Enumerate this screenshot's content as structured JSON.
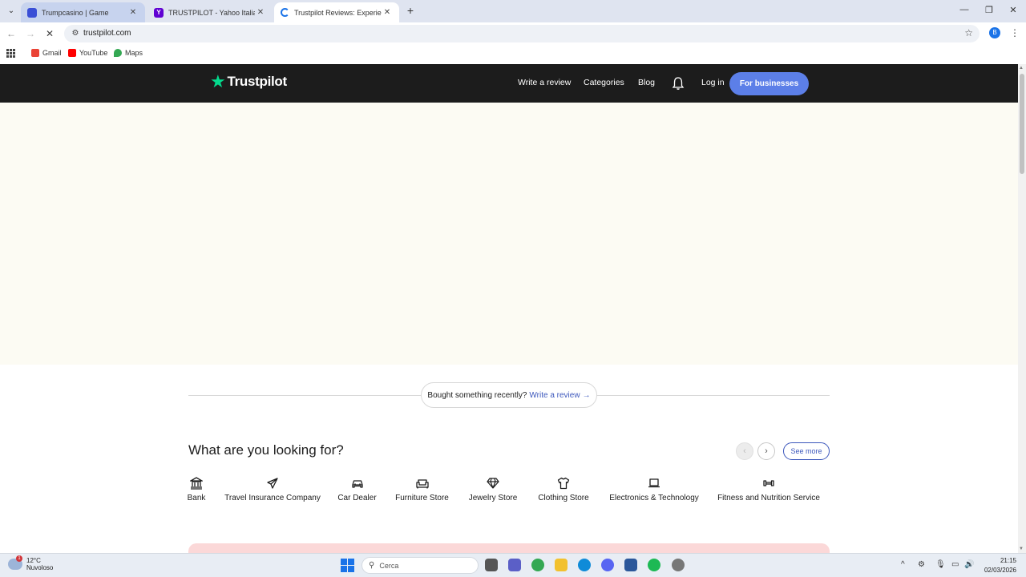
{
  "browser": {
    "tabs": [
      {
        "title": "Trumpcasino | Game",
        "favicon_color": "#3a4fd6",
        "active": false
      },
      {
        "title": "TRUSTPILOT - Yahoo Italia Risultati",
        "favicon_color": "#6001d2",
        "active": false
      },
      {
        "title": "Trustpilot Reviews: Experience the power",
        "favicon_color": "#1a73e8",
        "active": true
      }
    ],
    "new_tab": "+",
    "url": "trustpilot.com",
    "profile_initial": "B",
    "bookmarks": [
      {
        "label": "Gmail",
        "icon": "gmail-icon",
        "color": "#ea4335"
      },
      {
        "label": "YouTube",
        "icon": "youtube-icon",
        "color": "#ff0000"
      },
      {
        "label": "Maps",
        "icon": "maps-icon",
        "color": "#34a853"
      }
    ]
  },
  "site": {
    "logo_text": "Trustpilot",
    "brand_color": "#04da8d",
    "nav": {
      "write_review": "Write a review",
      "categories": "Categories",
      "blog": "Blog",
      "login": "Log in",
      "for_businesses": "For businesses"
    },
    "review_prompt": {
      "text": "Bought something recently?",
      "link": "Write a review",
      "arrow": "→"
    },
    "categories_section": {
      "title": "What are you looking for?",
      "prev": "‹",
      "next": "›",
      "see_more": "See more",
      "items": [
        {
          "label": "Bank",
          "icon": "bank-icon"
        },
        {
          "label": "Travel Insurance Company",
          "icon": "airplane-icon"
        },
        {
          "label": "Car Dealer",
          "icon": "car-icon"
        },
        {
          "label": "Furniture Store",
          "icon": "sofa-icon"
        },
        {
          "label": "Jewelry Store",
          "icon": "diamond-icon"
        },
        {
          "label": "Clothing Store",
          "icon": "shirt-icon"
        },
        {
          "label": "Electronics & Technology",
          "icon": "laptop-icon"
        },
        {
          "label": "Fitness and Nutrition Service",
          "icon": "dumbbell-icon"
        }
      ]
    }
  },
  "taskbar": {
    "weather_temp": "12°C",
    "weather_desc": "Nuvoloso",
    "weather_badge": "1",
    "search_placeholder": "Cerca",
    "time": "21:15",
    "date": "02/03/2026"
  }
}
